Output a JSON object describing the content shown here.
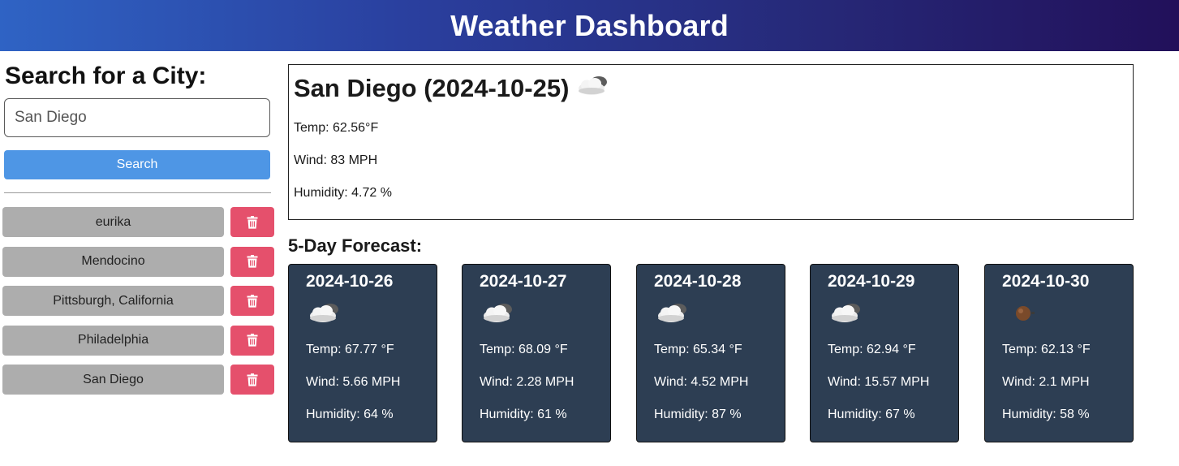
{
  "header": {
    "title": "Weather Dashboard"
  },
  "sidebar": {
    "search_title": "Search for a City:",
    "search_value": "San Diego",
    "search_button": "Search",
    "history": [
      {
        "city": "eurika"
      },
      {
        "city": "Mendocino"
      },
      {
        "city": "Pittsburgh, California"
      },
      {
        "city": "Philadelphia"
      },
      {
        "city": "San Diego"
      }
    ],
    "delete_icon": "trash-icon"
  },
  "current": {
    "title": "San Diego (2024-10-25)",
    "icon": "partly-cloudy-icon",
    "temp": "Temp: 62.56°F",
    "wind": "Wind: 83 MPH",
    "humidity": "Humidity: 4.72 %"
  },
  "forecast": {
    "title": "5-Day Forecast:",
    "days": [
      {
        "date": "2024-10-26",
        "icon": "partly-cloudy-icon",
        "temp": "Temp: 67.77 °F",
        "wind": "Wind: 5.66 MPH",
        "humidity": "Humidity: 64 %"
      },
      {
        "date": "2024-10-27",
        "icon": "partly-cloudy-icon",
        "temp": "Temp: 68.09 °F",
        "wind": "Wind: 2.28 MPH",
        "humidity": "Humidity: 61 %"
      },
      {
        "date": "2024-10-28",
        "icon": "partly-cloudy-icon",
        "temp": "Temp: 65.34 °F",
        "wind": "Wind: 4.52 MPH",
        "humidity": "Humidity: 87 %"
      },
      {
        "date": "2024-10-29",
        "icon": "partly-cloudy-icon",
        "temp": "Temp: 62.94 °F",
        "wind": "Wind: 15.57 MPH",
        "humidity": "Humidity: 67 %"
      },
      {
        "date": "2024-10-30",
        "icon": "clear-sky-icon",
        "temp": "Temp: 62.13 °F",
        "wind": "Wind: 2.1 MPH",
        "humidity": "Humidity: 58 %"
      }
    ]
  },
  "colors": {
    "header_start": "#2f63c4",
    "header_end": "#22105a",
    "search_button": "#4e96e5",
    "history_button": "#adadad",
    "delete_button": "#e5506c",
    "card_bg": "#2d3e53"
  }
}
